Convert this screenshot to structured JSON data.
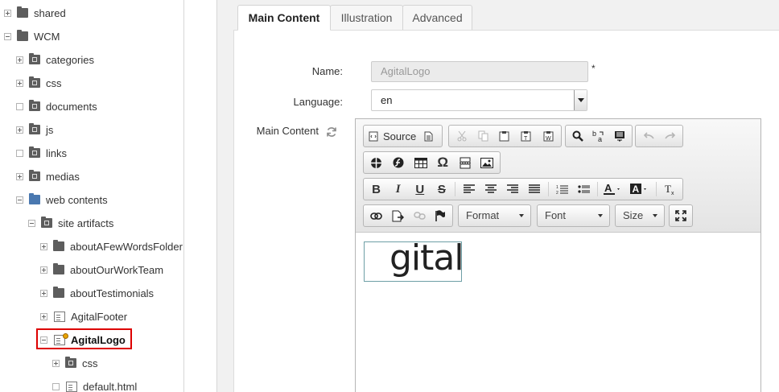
{
  "tree": {
    "items": [
      {
        "label": "shared",
        "expander": "plus",
        "icon": "folder-icon"
      },
      {
        "label": "WCM",
        "expander": "minus",
        "icon": "folder-icon"
      },
      {
        "label": "categories",
        "expander": "plus",
        "icon": "category-folder-icon"
      },
      {
        "label": "css",
        "expander": "plus",
        "icon": "css-folder-icon"
      },
      {
        "label": "documents",
        "expander": "none",
        "icon": "documents-folder-icon"
      },
      {
        "label": "js",
        "expander": "plus",
        "icon": "js-folder-icon"
      },
      {
        "label": "links",
        "expander": "none",
        "icon": "links-folder-icon"
      },
      {
        "label": "medias",
        "expander": "plus",
        "icon": "medias-folder-icon"
      },
      {
        "label": "web contents",
        "expander": "minus",
        "icon": "blue-folder-icon"
      },
      {
        "label": "site artifacts",
        "expander": "minus",
        "icon": "artifact-folder-icon"
      },
      {
        "label": "aboutAFewWordsFolder",
        "expander": "plus",
        "icon": "folder-icon"
      },
      {
        "label": "aboutOurWorkTeam",
        "expander": "plus",
        "icon": "folder-icon"
      },
      {
        "label": "aboutTestimonials",
        "expander": "plus",
        "icon": "folder-icon"
      },
      {
        "label": "AgitalFooter",
        "expander": "plus",
        "icon": "document-icon"
      },
      {
        "label": "AgitalLogo",
        "expander": "minus",
        "icon": "locked-document-icon",
        "selected": true
      },
      {
        "label": "css",
        "expander": "plus",
        "icon": "css-folder-icon"
      },
      {
        "label": "default.html",
        "expander": "none",
        "icon": "html-file-icon"
      }
    ]
  },
  "tabs": [
    {
      "label": "Main Content",
      "active": true
    },
    {
      "label": "Illustration",
      "active": false
    },
    {
      "label": "Advanced",
      "active": false
    }
  ],
  "form": {
    "name_label": "Name:",
    "name_value": "AgitalLogo",
    "required_mark": "*",
    "language_label": "Language:",
    "language_value": "en",
    "main_content_label": "Main Content"
  },
  "editor": {
    "source_label": "Source",
    "format_label": "Format",
    "font_label": "Font",
    "size_label": "Size",
    "content_text": "gital"
  },
  "colors": {
    "selection_border": "#dd0000",
    "web_contents_folder": "#4a78b0",
    "lock_badge": "#e8a400"
  }
}
